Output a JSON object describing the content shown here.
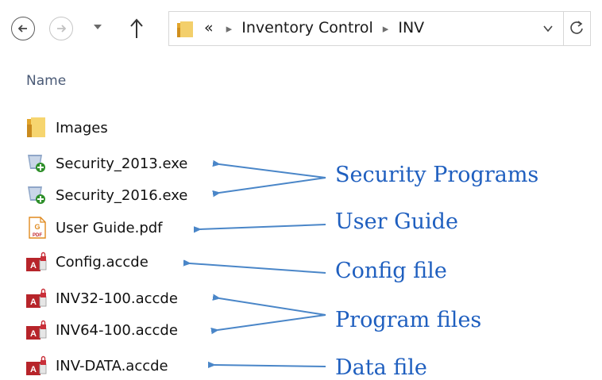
{
  "address_bar": {
    "overflow": "«",
    "crumbs": [
      "Inventory Control",
      "INV"
    ]
  },
  "column_header": "Name",
  "files": [
    {
      "name": "Images",
      "icon": "folder-icon"
    },
    {
      "name": "Security_2013.exe",
      "icon": "shield-exe-icon"
    },
    {
      "name": "Security_2016.exe",
      "icon": "shield-exe-icon"
    },
    {
      "name": "User Guide.pdf",
      "icon": "pdf-icon"
    },
    {
      "name": "Config.accde",
      "icon": "access-locked-icon"
    },
    {
      "name": "INV32-100.accde",
      "icon": "access-locked-icon"
    },
    {
      "name": "INV64-100.accde",
      "icon": "access-locked-icon"
    },
    {
      "name": "INV-DATA.accde",
      "icon": "access-locked-icon"
    }
  ],
  "annotations": {
    "security": "Security Programs",
    "guide": "User Guide",
    "config": "Config file",
    "program": "Program files",
    "data": "Data file"
  },
  "colors": {
    "annotation": "#1f5fbf",
    "arrow": "#4a86c8",
    "access_red": "#b7242a",
    "folder": "#e8b43a"
  }
}
